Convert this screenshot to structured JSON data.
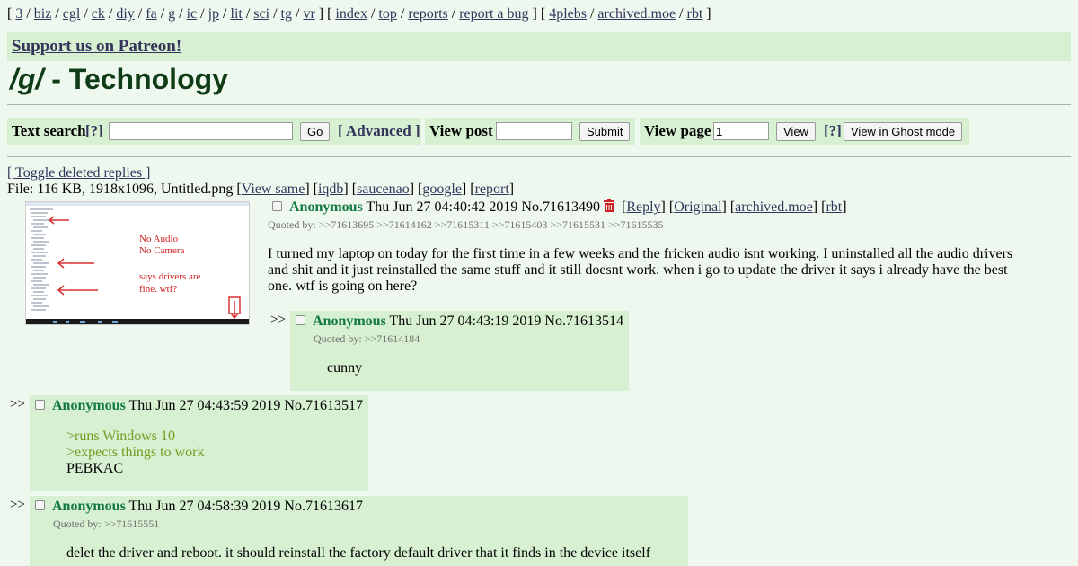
{
  "nav": {
    "open1": "[",
    "boards": [
      "3",
      "biz",
      "cgl",
      "ck",
      "diy",
      "fa",
      "g",
      "ic",
      "jp",
      "lit",
      "sci",
      "tg",
      "vr"
    ],
    "close_open2": "] [",
    "site_links": [
      "index",
      "top",
      "reports",
      "report a bug"
    ],
    "close_open3": "] [",
    "archives": [
      "4plebs",
      "archived.moe",
      "rbt"
    ],
    "close3": "]"
  },
  "patreon": {
    "label": "Support us on Patreon!"
  },
  "board": {
    "code": "/g/",
    "title": " - Technology"
  },
  "search": {
    "text_search_label": "Text search",
    "help_label": "[?]",
    "go_label": "Go",
    "advanced_label": "[ Advanced ]",
    "view_post_label": "View post",
    "submit_label": "Submit",
    "view_page_label": "View page",
    "page_value": "1",
    "view_label": "View",
    "help2_label": "[?]",
    "ghost_label": "View in Ghost mode"
  },
  "thread": {
    "toggle_label": "[ Toggle deleted replies ]",
    "file_prefix": "File: 116 KB, 1918x1096, Untitled.png [",
    "view_same": "View same",
    "iqdb": "iqdb",
    "saucenao": "saucenao",
    "google": "google",
    "report": "report",
    "thumb_text": [
      "No Audio",
      "No Camera",
      "says drivers are",
      "fine. wtf?"
    ],
    "op": {
      "name": "Anonymous",
      "date": "Thu Jun 27 04:40:42 2019",
      "no": "No.71613490",
      "reply": "Reply",
      "original": "Original",
      "archived": "archived.moe",
      "rbt": "rbt",
      "quoted_label": "Quoted by:",
      "quoted": [
        ">>71613695",
        ">>71614162",
        ">>71615311",
        ">>71615403",
        ">>71615531",
        ">>71615535"
      ],
      "text": "I turned my laptop on today for the first time in a few weeks and the fricken audio isnt working. I uninstalled all the audio drivers and shit and it just reinstalled the same stuff and it still doesnt work. when i go to update the driver it says i already have the best one. wtf is going on here?"
    },
    "replies": [
      {
        "arrows": ">>",
        "name": "Anonymous",
        "date": "Thu Jun 27 04:43:19 2019",
        "no": "No.71613514",
        "quoted_label": "Quoted by:",
        "quoted": ">>71614184",
        "lines": [
          "cunny"
        ]
      },
      {
        "arrows": ">>",
        "name": "Anonymous",
        "date": "Thu Jun 27 04:43:59 2019",
        "no": "No.71613517",
        "lines": [
          ">runs Windows 10",
          ">expects things to work",
          "PEBKAC"
        ]
      },
      {
        "arrows": ">>",
        "name": "Anonymous",
        "date": "Thu Jun 27 04:58:39 2019",
        "no": "No.71613617",
        "quoted_label": "Quoted by:",
        "quoted": ">>71615551",
        "lines": [
          "delet the driver and reboot. it should reinstall the factory default driver that it finds in the device itself"
        ]
      }
    ]
  }
}
